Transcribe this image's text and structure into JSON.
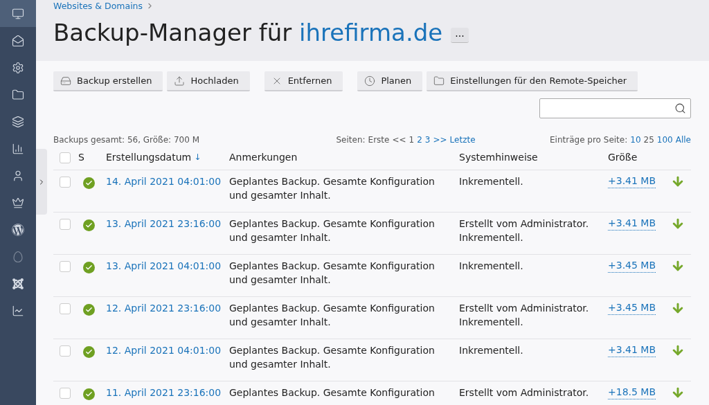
{
  "sidebar": {
    "items": [
      {
        "selected": true
      },
      {
        "selected": false
      },
      {
        "selected": false
      },
      {
        "selected": false
      },
      {
        "selected": false
      },
      {
        "selected": false
      },
      {
        "selected": false
      },
      {
        "selected": false
      },
      {
        "selected": false
      },
      {
        "selected": false
      },
      {
        "selected": false
      },
      {
        "selected": false
      }
    ]
  },
  "breadcrumb": "Websites & Domains",
  "title": {
    "text": "Backup-Manager für",
    "domain": "ihrefirma.de",
    "more": "..."
  },
  "toolbar": [
    {
      "label": "Backup erstellen"
    },
    {
      "label": "Hochladen"
    },
    {
      "label": "Entfernen"
    },
    {
      "label": "Planen"
    },
    {
      "label": "Einstellungen für den Remote-Speicher"
    }
  ],
  "summary": "Backups gesamt: 56, Größe: 700 M",
  "pages": {
    "label": "Seiten:",
    "items": [
      {
        "text": "Erste",
        "link": false
      },
      {
        "text": "<<",
        "link": false
      },
      {
        "text": "1",
        "link": false
      },
      {
        "text": "2",
        "link": true
      },
      {
        "text": "3",
        "link": true
      },
      {
        "text": ">>",
        "link": true
      },
      {
        "text": "Letzte",
        "link": true
      }
    ]
  },
  "per_page": {
    "label": "Einträge pro Seite:",
    "items": [
      {
        "text": "10",
        "selected": false
      },
      {
        "text": "25",
        "selected": true
      },
      {
        "text": "100",
        "selected": false
      },
      {
        "text": "Alle",
        "selected": false
      }
    ]
  },
  "table": {
    "select_all_checked": false,
    "columns": [
      "S",
      "Erstellungsdatum",
      "Anmerkungen",
      "Systemhinweise",
      "Größe"
    ],
    "sort_arrow": "↓",
    "rows": [
      {
        "checked": false,
        "success": true,
        "date": "14. April 2021 04:01:00",
        "notes": [
          "Geplantes Backup. Gesamte Konfiguration",
          "und gesamter Inhalt."
        ],
        "system": [
          "Inkrementell."
        ],
        "size": "+3.41 MB"
      },
      {
        "checked": false,
        "success": true,
        "date": "13. April 2021 23:16:00",
        "notes": [
          "Geplantes Backup. Gesamte Konfiguration",
          "und gesamter Inhalt."
        ],
        "system": [
          "Erstellt vom Administrator.",
          "Inkrementell."
        ],
        "size": "+3.41 MB"
      },
      {
        "checked": false,
        "success": true,
        "date": "13. April 2021 04:01:00",
        "notes": [
          "Geplantes Backup. Gesamte Konfiguration",
          "und gesamter Inhalt."
        ],
        "system": [
          "Inkrementell."
        ],
        "size": "+3.45 MB"
      },
      {
        "checked": false,
        "success": true,
        "date": "12. April 2021 23:16:00",
        "notes": [
          "Geplantes Backup. Gesamte Konfiguration",
          "und gesamter Inhalt."
        ],
        "system": [
          "Erstellt vom Administrator.",
          "Inkrementell."
        ],
        "size": "+3.45 MB"
      },
      {
        "checked": false,
        "success": true,
        "date": "12. April 2021 04:01:00",
        "notes": [
          "Geplantes Backup. Gesamte Konfiguration",
          "und gesamter Inhalt."
        ],
        "system": [
          "Inkrementell."
        ],
        "size": "+3.41 MB"
      },
      {
        "checked": false,
        "success": true,
        "date": "11. April 2021 23:16:00",
        "notes": [
          "Geplantes Backup. Gesamte Konfiguration"
        ],
        "system": [
          "Erstellt vom Administrator."
        ],
        "size": "+18.5 MB"
      }
    ]
  }
}
